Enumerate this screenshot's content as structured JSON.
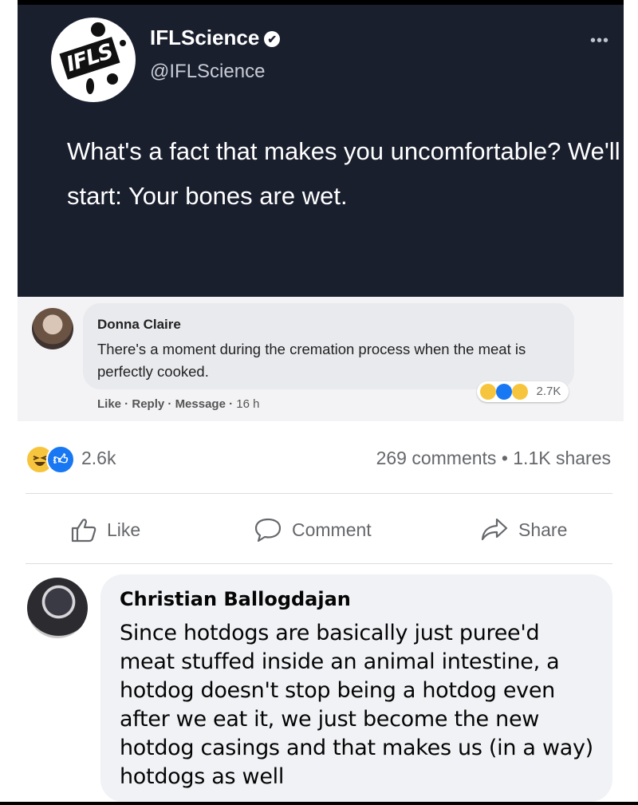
{
  "tweet": {
    "name": "IFLScience",
    "handle": "@IFLScience",
    "logo_text": "IFLS",
    "text": "What's a fact that makes you uncomfortable? We'll start: Your bones are wet.",
    "more_icon": "ellipsis-icon"
  },
  "donna_comment": {
    "name": "Donna Claire",
    "text": "There's a moment during the cremation process when the meat is perfectly cooked.",
    "reaction_count": "2.7K",
    "actions": {
      "like": "Like",
      "reply": "Reply",
      "message": "Message",
      "time": "16 h"
    }
  },
  "post_stats": {
    "reaction_count": "2.6k",
    "comments_shares": "269 comments • 1.1K shares"
  },
  "actions": {
    "like": "Like",
    "comment": "Comment",
    "share": "Share"
  },
  "christian_comment": {
    "name": "Christian Ballogdajan",
    "text": "Since hotdogs are basically just puree'd meat stuffed inside an animal intestine, a hotdog doesn't stop being a hotdog even after we eat it, we just become the new hotdog casings and that makes us (in a way) hotdogs as well"
  },
  "colors": {
    "tweet_bg": "#1a1f2e",
    "fb_blue": "#1877f2",
    "muted_text": "#65676b",
    "bubble": "#f0f2f5"
  }
}
